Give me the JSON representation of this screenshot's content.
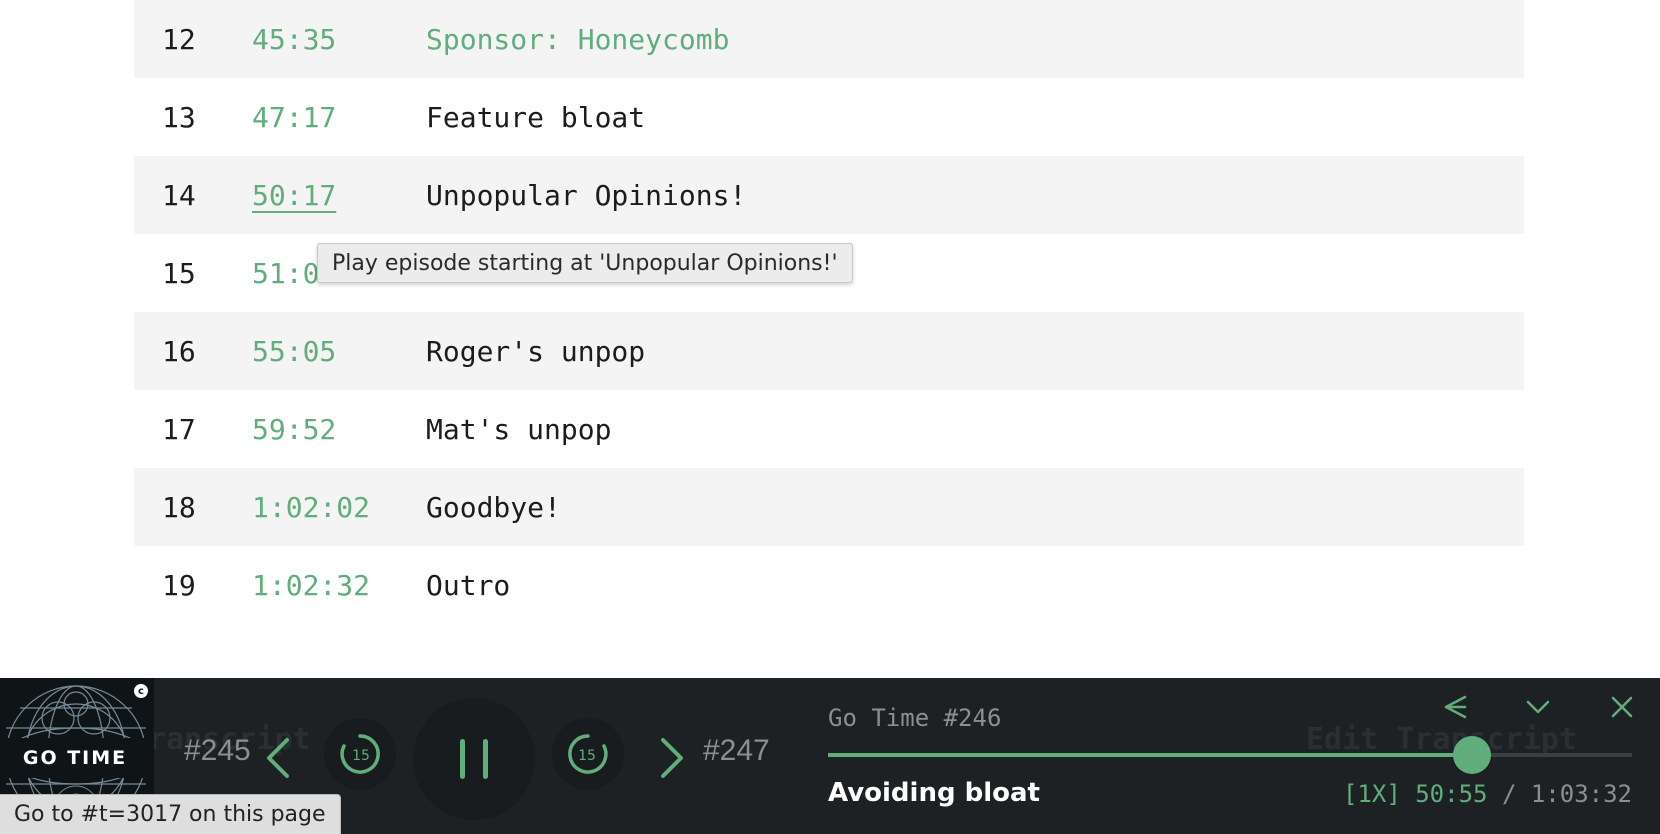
{
  "chapters": [
    {
      "number": "12",
      "time": "45:35",
      "title": "Sponsor: Honeycomb"
    },
    {
      "number": "13",
      "time": "47:17",
      "title": "Feature bloat"
    },
    {
      "number": "14",
      "time": "50:17",
      "title": "Unpopular Opinions!"
    },
    {
      "number": "15",
      "time": "51:0",
      "title": ""
    },
    {
      "number": "16",
      "time": "55:05",
      "title": "Roger's unpop"
    },
    {
      "number": "17",
      "time": "59:52",
      "title": "Mat's unpop"
    },
    {
      "number": "18",
      "time": "1:02:02",
      "title": "Goodbye!"
    },
    {
      "number": "19",
      "time": "1:02:32",
      "title": "Outro"
    }
  ],
  "tooltip": "Play episode starting at 'Unpopular Opinions!'",
  "behind_player": {
    "transcript_heading": "ranscript",
    "edit_transcript": "Edit Transcript"
  },
  "player": {
    "artwork_label": "GO TIME",
    "artwork_badge": "c",
    "prev_episode": "#245",
    "next_episode": "#247",
    "skip_seconds": "15",
    "episode_label": "Go Time #246",
    "episode_title": "Avoiding bloat",
    "speed": "[1X]",
    "current_time": "50:55",
    "separator": "/",
    "duration": "1:03:32",
    "progress": 0.8015
  },
  "status_url": "Go to #t=3017 on this page",
  "colors": {
    "accent": "#61ad7c",
    "player_bg": "#1d2124",
    "row_shade": "#f4f4f4"
  }
}
